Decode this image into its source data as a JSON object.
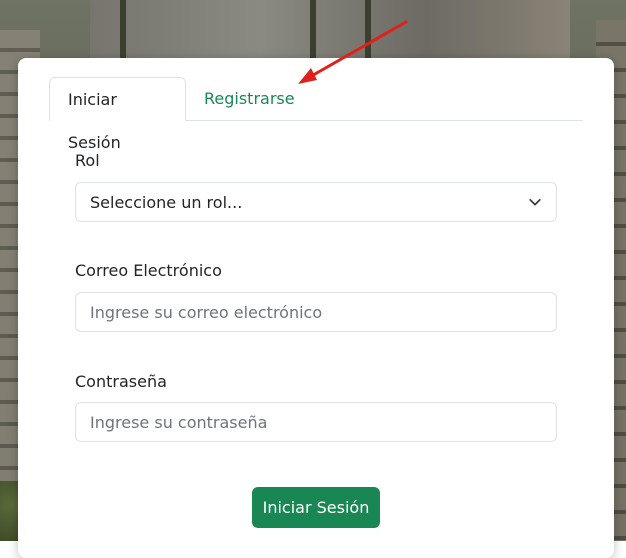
{
  "tabs": {
    "login_label": "Iniciar Sesión",
    "register_label": "Registrarse"
  },
  "form": {
    "role_label": "Rol",
    "role_selected": "Seleccione un rol...",
    "email_label": "Correo Electrónico",
    "email_placeholder": "Ingrese su correo electrónico",
    "password_label": "Contraseña",
    "password_placeholder": "Ingrese su contraseña",
    "submit_label": "Iniciar Sesión"
  },
  "colors": {
    "accent_green": "#198754",
    "annotation_arrow": "#e0201b"
  },
  "icons": {
    "select_chevron": "chevron-down-icon"
  }
}
